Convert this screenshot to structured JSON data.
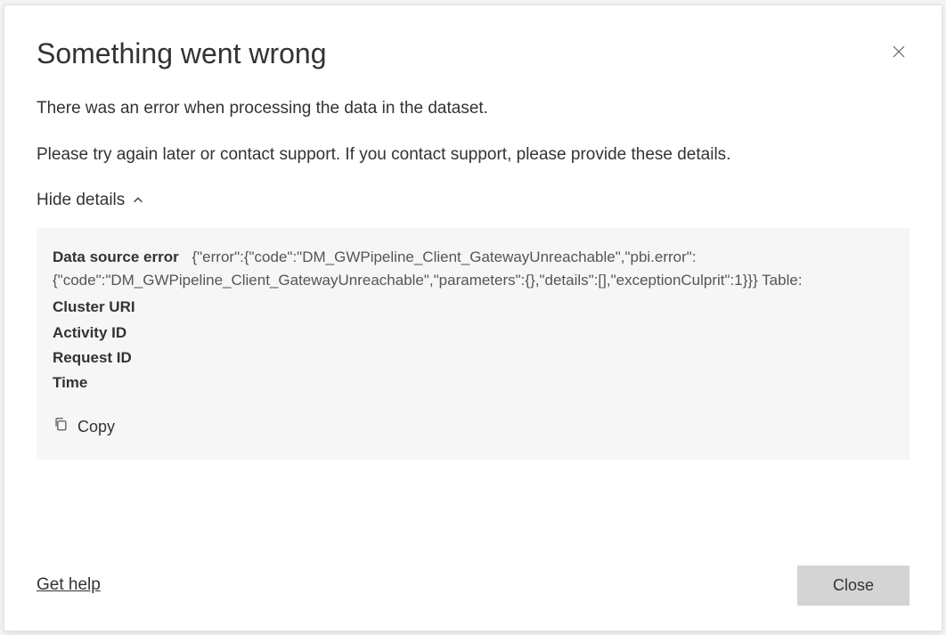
{
  "dialog": {
    "title": "Something went wrong",
    "message1": "There was an error when processing the data in the dataset.",
    "message2": "Please try again later or contact support. If you contact support, please provide these details.",
    "toggle_label": "Hide details"
  },
  "details": {
    "data_source_error_label": "Data source error",
    "error_json": "{\"error\":{\"code\":\"DM_GWPipeline_Client_GatewayUnreachable\",\"pbi.error\":{\"code\":\"DM_GWPipeline_Client_GatewayUnreachable\",\"parameters\":{},\"details\":[],\"exceptionCulprit\":1}}} Table:",
    "cluster_uri_label": "Cluster URI",
    "activity_id_label": "Activity ID",
    "request_id_label": "Request ID",
    "time_label": "Time",
    "copy_label": "Copy"
  },
  "footer": {
    "get_help": "Get help",
    "close": "Close"
  }
}
